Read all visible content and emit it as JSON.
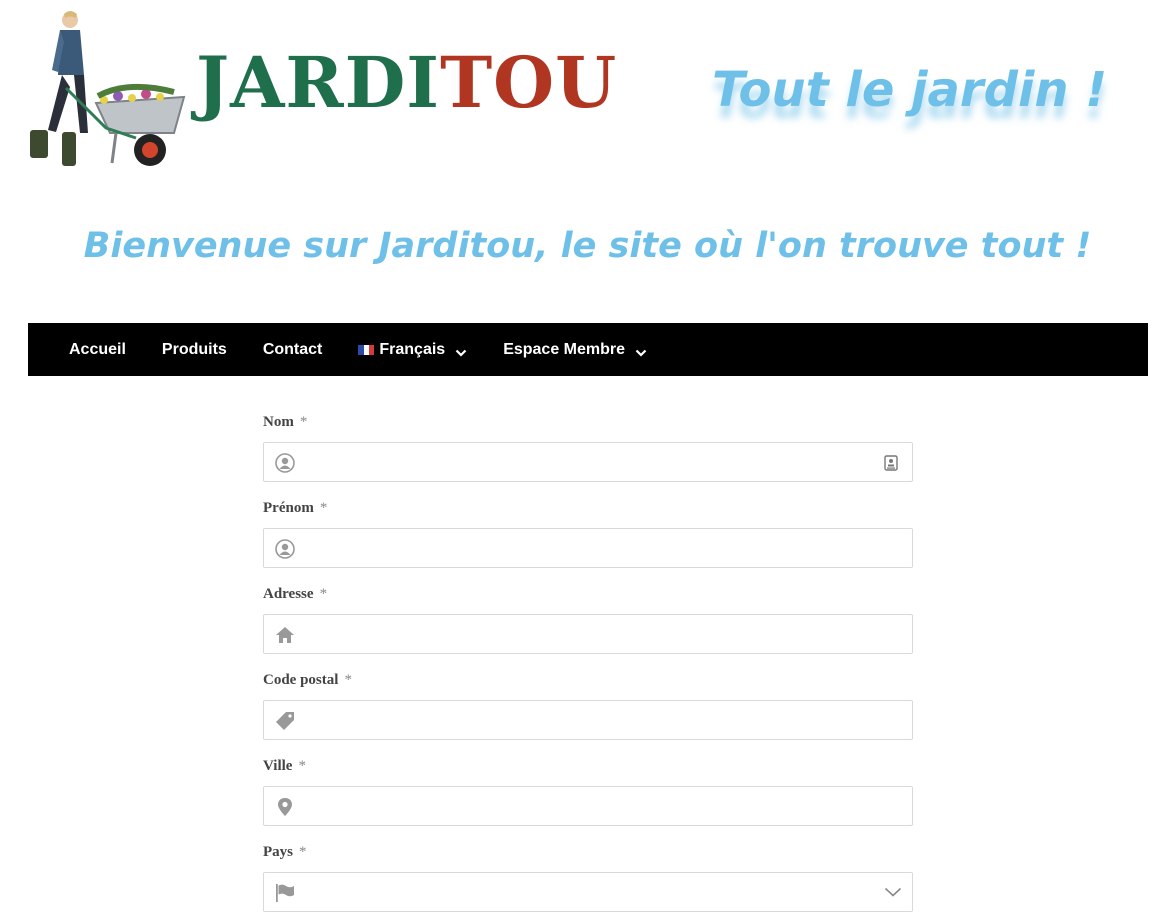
{
  "brand": {
    "part1": "JARDI",
    "part2": "TOU",
    "color1": "#1f6e4c",
    "color2": "#b03622"
  },
  "tagline": "Tout le jardin !",
  "welcome": "Bienvenue sur Jarditou, le site où l'on trouve tout !",
  "accent_color": "#6ec0e8",
  "nav": {
    "items": [
      {
        "label": "Accueil"
      },
      {
        "label": "Produits"
      },
      {
        "label": "Contact"
      },
      {
        "label": "Français",
        "icon": "french-flag-icon",
        "has_dropdown": true
      },
      {
        "label": "Espace Membre",
        "has_dropdown": true
      }
    ]
  },
  "form": {
    "required_mark": "*",
    "fields": [
      {
        "label": "Nom",
        "value": "",
        "icon": "user-icon"
      },
      {
        "label": "Prénom",
        "value": "",
        "icon": "user-icon"
      },
      {
        "label": "Adresse",
        "value": "",
        "icon": "home-icon"
      },
      {
        "label": "Code postal",
        "value": "",
        "icon": "tag-icon"
      },
      {
        "label": "Ville",
        "value": "",
        "icon": "map-pin-icon"
      },
      {
        "label": "Pays",
        "value": "",
        "icon": "flag-icon"
      }
    ]
  }
}
